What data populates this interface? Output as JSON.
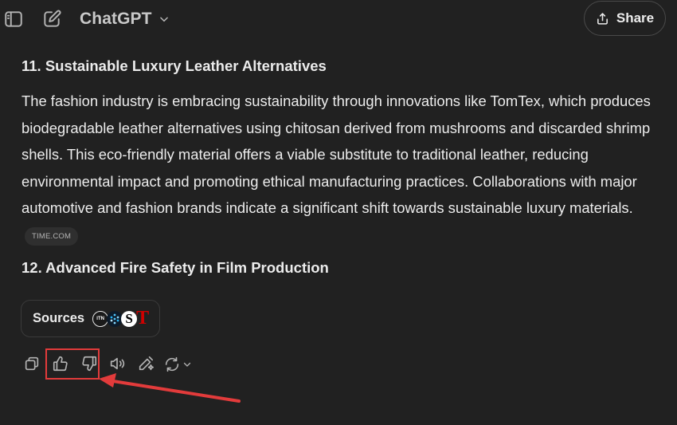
{
  "header": {
    "model_name": "ChatGPT",
    "share_label": "Share",
    "icons": [
      "sidebar-toggle-icon",
      "new-chat-icon",
      "chevron-down-icon",
      "share-icon"
    ]
  },
  "content": {
    "heading_11": "11. Sustainable Luxury Leather Alternatives",
    "paragraph_lines": [
      "The fashion industry is embracing sustainability through innovations like TomTex, which produces",
      "biodegradable leather alternatives using chitosan derived from mushrooms and discarded shrimp",
      "shells. This eco-friendly material offers a viable substitute to traditional leather, reducing",
      "environmental impact and promoting ethical manufacturing practices. Collaborations with major",
      "automotive and fashion brands indicate a significant shift towards sustainable luxury materials."
    ],
    "citation": "TIME.COM",
    "heading_12": "12. Advanced Fire Safety in Film Production"
  },
  "sources": {
    "label": "Sources",
    "favicons": [
      {
        "name": "itn-favicon",
        "text": "ITN"
      },
      {
        "name": "dots-favicon",
        "text": ""
      },
      {
        "name": "s-favicon",
        "text": "S"
      },
      {
        "name": "t-favicon",
        "text": "T"
      }
    ]
  },
  "actions": [
    "copy-icon",
    "thumbs-up-icon",
    "thumbs-down-icon",
    "read-aloud-icon",
    "edit-icon",
    "regenerate-icon"
  ],
  "annotation": {
    "highlight_color": "#e23b3b"
  },
  "colors": {
    "background": "#212121",
    "text": "#ececec",
    "muted": "#b4b4b4"
  }
}
